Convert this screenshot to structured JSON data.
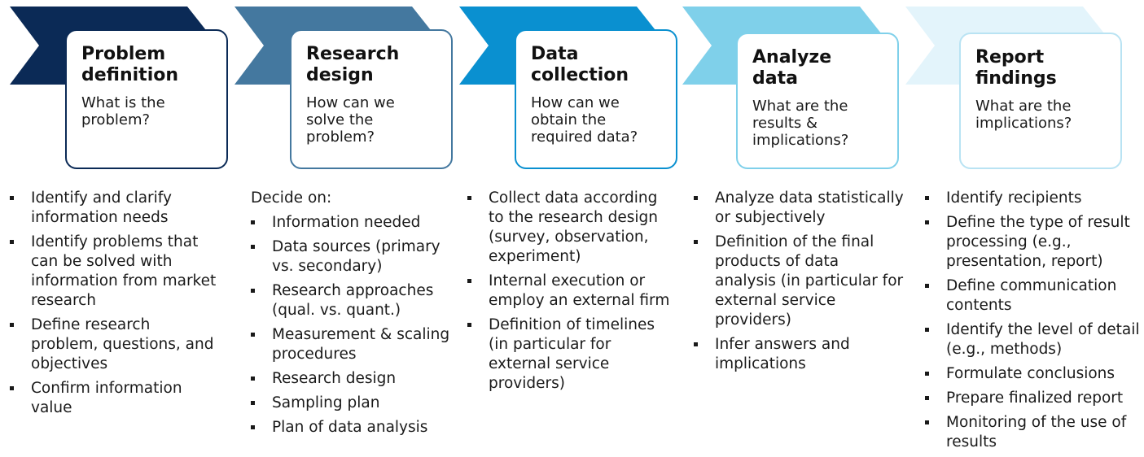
{
  "stages": [
    {
      "title": "Problem definition",
      "question": "What is the problem?",
      "color": "#0b2a56",
      "border": "#0b2a56",
      "lead": "",
      "items": [
        "Identify and clarify information needs",
        "Identify problems that can be solved with information from market research",
        "Define research problem, questions, and objectives",
        "Confirm information value"
      ]
    },
    {
      "title": "Research design",
      "question": "How can we solve the problem?",
      "color": "#44789f",
      "border": "#44789f",
      "lead": "Decide on:",
      "items": [
        "Information needed",
        "Data sources (primary vs. secondary)",
        "Research approaches (qual. vs. quant.)",
        "Measurement & scaling procedures",
        "Research design",
        "Sampling plan",
        "Plan of data analysis"
      ]
    },
    {
      "title": "Data collection",
      "question": "How can we obtain the required data?",
      "color": "#0a90d0",
      "border": "#0a90d0",
      "lead": "",
      "items": [
        "Collect data according to the research design (survey, observation, experiment)",
        "Internal execution or employ an external firm",
        "Definition of timelines (in particular for external service providers)"
      ]
    },
    {
      "title": "Analyze data",
      "question": "What are the results & implications?",
      "color": "#7fd0ea",
      "border": "#7fd0ea",
      "lead": "",
      "items": [
        "Analyze data statistically or subjectively",
        "Definition of the final products of data analysis (in particular for external service providers)",
        "Infer answers and implications"
      ]
    },
    {
      "title": "Report findings",
      "question": "What are the implications?",
      "color": "#e3f4fb",
      "border": "#b9e3f3",
      "lead": "",
      "items": [
        "Identify recipients",
        "Define the type of result processing (e.g., presentation, report)",
        "Define communication contents",
        "Identify the level of detail (e.g., methods)",
        "Formulate conclusions",
        "Prepare finalized report",
        "Monitoring of the use of results"
      ]
    }
  ]
}
